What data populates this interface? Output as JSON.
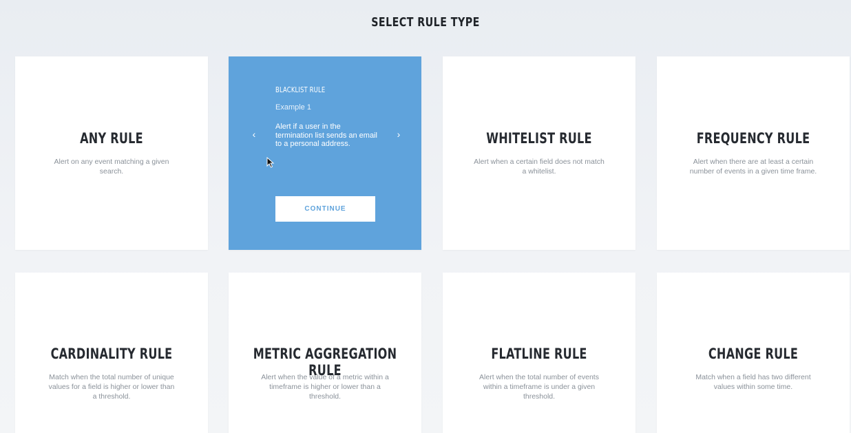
{
  "page": {
    "title": "SELECT RULE TYPE"
  },
  "cards": {
    "any": {
      "name": "ANY RULE",
      "description": "Alert on any event matching a given search."
    },
    "blacklist": {
      "subtitle": "BLACKLIST RULE",
      "example": "Example 1",
      "body": "Alert if a user in the termination list sends an email to a personal address.",
      "prev_icon": "chevron-left-icon",
      "next_icon": "chevron-right-icon",
      "continue_label": "CONTINUE",
      "accent": "#5fa3dc"
    },
    "whitelist": {
      "name": "WHITELIST RULE",
      "description": "Alert when a certain field does not match a whitelist."
    },
    "frequency": {
      "name": "FREQUENCY RULE",
      "description": "Alert when there are at least a certain number of events in a given time frame."
    },
    "cardinality": {
      "name": "CARDINALITY RULE",
      "description": "Match when the total number of unique values for a field is higher or lower than a threshold."
    },
    "metric_aggregation": {
      "name": "METRIC AGGREGATION RULE",
      "description": "Alert when the value of a metric within a timeframe is higher or lower than a threshold."
    },
    "flatline": {
      "name": "FLATLINE RULE",
      "description": "Alert when the total number of events within a timeframe is under a given threshold."
    },
    "change": {
      "name": "CHANGE RULE",
      "description": "Match when a field has two different values within some time."
    }
  }
}
